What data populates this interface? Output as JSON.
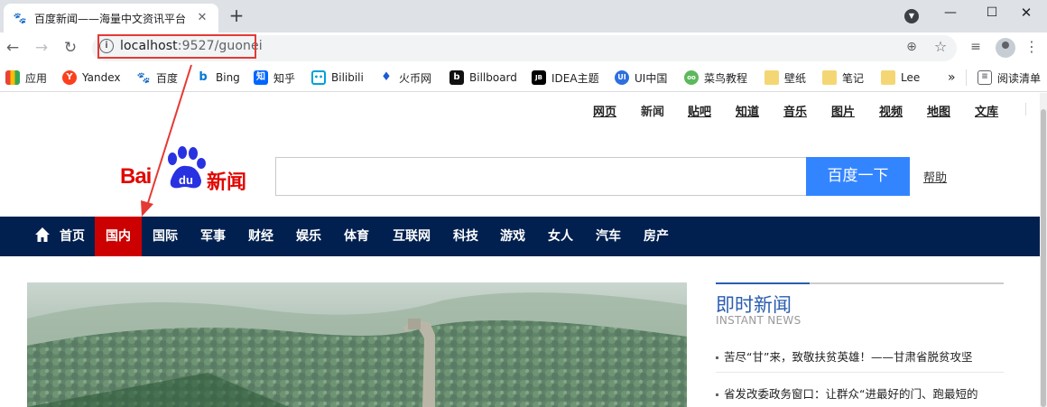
{
  "browser": {
    "tab_title": "百度新闻——海量中文资讯平台",
    "url_host": "localhost",
    "url_port_path": ":9527/guonei",
    "icons": [
      "info-icon",
      "zoom-icon",
      "star-icon",
      "reading-list-icon",
      "profile-icon",
      "menu-icon"
    ]
  },
  "bookmarks": [
    {
      "label": "应用",
      "icon": "apps-icon",
      "color": "#4285f4"
    },
    {
      "label": "Yandex",
      "icon": "yandex-icon",
      "color": "#fc3f1d"
    },
    {
      "label": "百度",
      "icon": "baidu-icon",
      "color": "#2932e1"
    },
    {
      "label": "Bing",
      "icon": "bing-icon",
      "color": "#0078d4"
    },
    {
      "label": "知乎",
      "icon": "zhihu-icon",
      "color": "#0066ff"
    },
    {
      "label": "Bilibili",
      "icon": "bilibili-icon",
      "color": "#00a1d6"
    },
    {
      "label": "火币网",
      "icon": "huobi-icon",
      "color": "#1c2b4b"
    },
    {
      "label": "Billboard",
      "icon": "billboard-icon",
      "color": "#111111"
    },
    {
      "label": "IDEA主题",
      "icon": "idea-icon",
      "color": "#000000"
    },
    {
      "label": "UI中国",
      "icon": "uichina-icon",
      "color": "#2d6fe0"
    },
    {
      "label": "菜鸟教程",
      "icon": "runoob-icon",
      "color": "#5cb85c"
    },
    {
      "label": "壁纸",
      "icon": "folder-icon",
      "color": "#f4d774"
    },
    {
      "label": "笔记",
      "icon": "folder-icon",
      "color": "#f4d774"
    },
    {
      "label": "Lee",
      "icon": "folder-icon",
      "color": "#f4d774"
    },
    {
      "label": "»",
      "icon": "more-bookmarks-icon",
      "color": "#5f6368"
    },
    {
      "label": "阅读清单",
      "icon": "reading-list-icon",
      "color": "#5f6368"
    }
  ],
  "topnav": [
    "网页",
    "新闻",
    "贴吧",
    "知道",
    "音乐",
    "图片",
    "视频",
    "地图",
    "文库"
  ],
  "logo": {
    "bai": "Bai",
    "du": "du",
    "news": "新闻"
  },
  "search": {
    "button": "百度一下",
    "help": "帮助",
    "value": ""
  },
  "channels": [
    "首页",
    "国内",
    "国际",
    "军事",
    "财经",
    "娱乐",
    "体育",
    "互联网",
    "科技",
    "游戏",
    "女人",
    "汽车",
    "房产"
  ],
  "active_channel": "国内",
  "instant": {
    "title": "即时新闻",
    "subtitle": "INSTANT NEWS",
    "items": [
      "苦尽“甘”来，致敬扶贫英雄！——甘肃省脱贫攻坚",
      "省发改委政务窗口：让群众“进最好的门、跑最短的"
    ]
  },
  "colors": {
    "channel_bar": "#01204f",
    "active": "#cc0000",
    "search_button": "#3385ff",
    "annotation": "#e53935"
  }
}
